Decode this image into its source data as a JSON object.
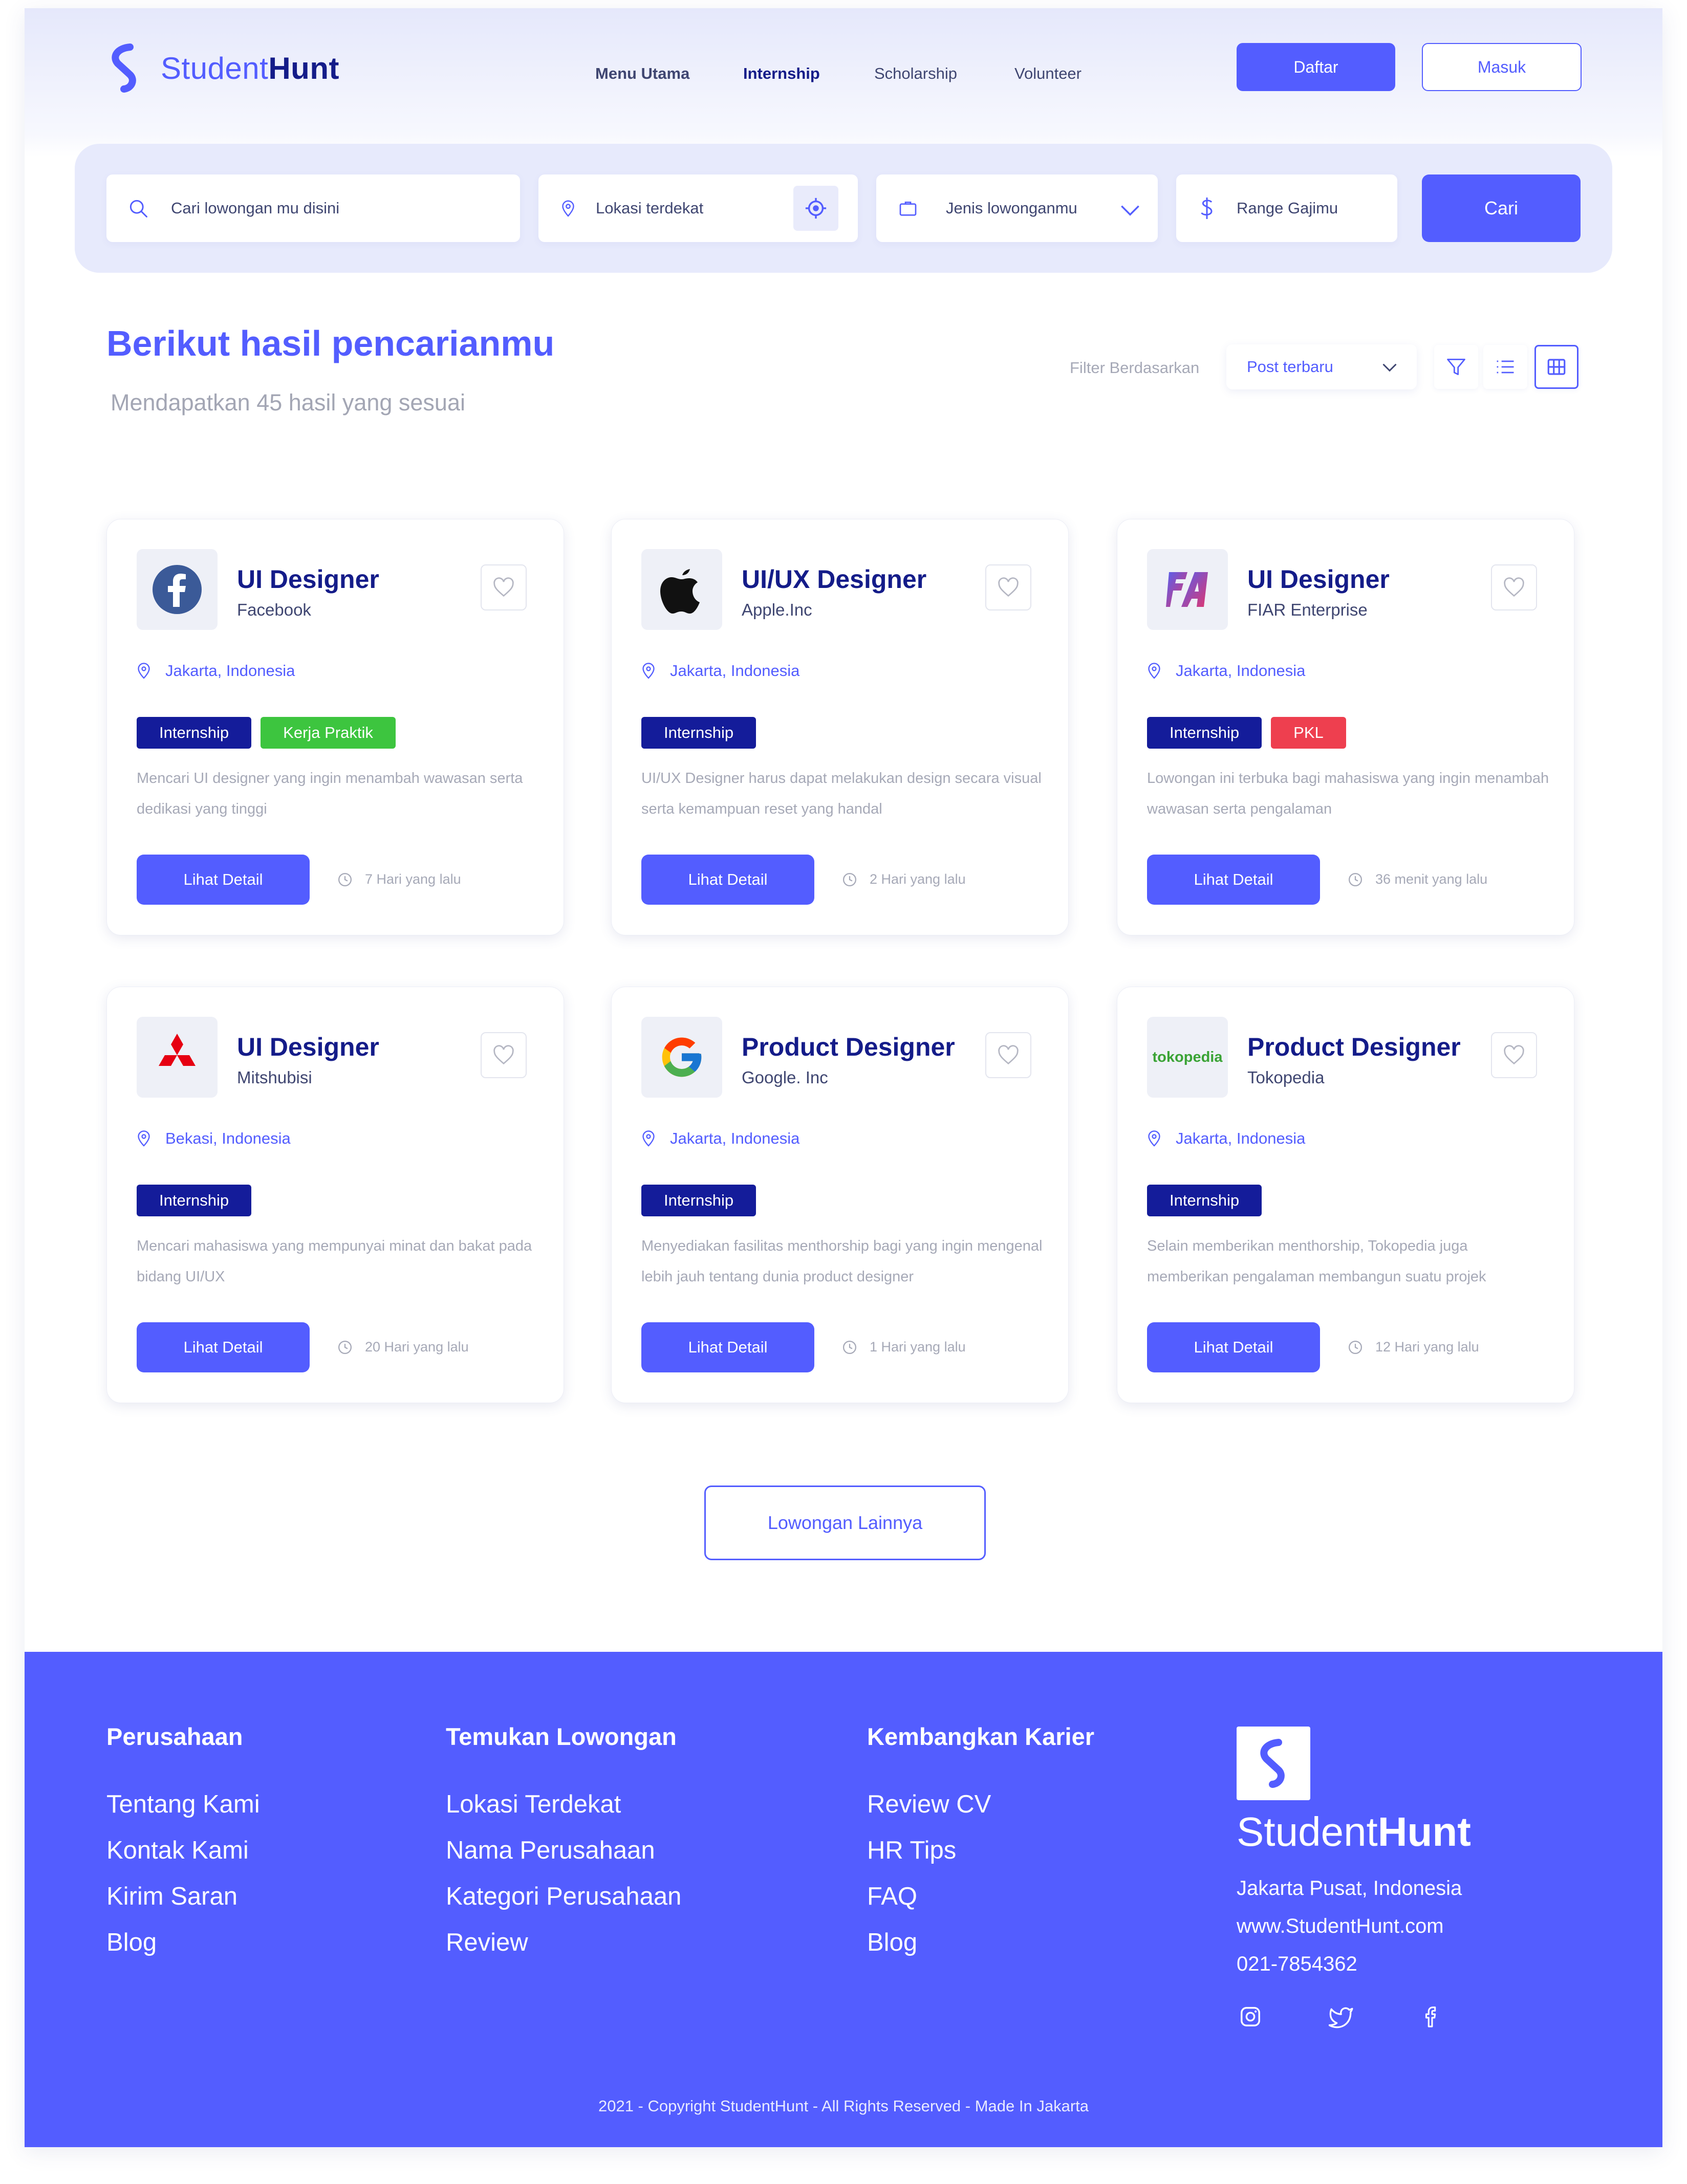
{
  "brand": {
    "prefix": "Student",
    "bold": "Hunt"
  },
  "nav": {
    "items": [
      "Menu Utama",
      "Internship",
      "Scholarship",
      "Volunteer"
    ],
    "active": "Internship"
  },
  "auth": {
    "register": "Daftar",
    "login": "Masuk"
  },
  "search": {
    "keyword_placeholder": "Cari lowongan mu disini",
    "location_placeholder": "Lokasi terdekat",
    "type_placeholder": "Jenis lowonganmu",
    "salary_placeholder": "Range Gajimu",
    "submit": "Cari"
  },
  "results": {
    "title": "Berikut hasil pencarianmu",
    "subtitle": "Mendapatkan 45 hasil yang sesuai",
    "filter_label": "Filter Berdasarkan",
    "filter_value": "Post terbaru",
    "active_view": "grid"
  },
  "jobs": [
    {
      "title": "UI Designer",
      "company": "Facebook",
      "logo": "facebook-logo",
      "location": "Jakarta, Indonesia",
      "tags": [
        {
          "label": "Internship",
          "color": "#141c9a"
        },
        {
          "label": "Kerja Praktik",
          "color": "#3dc53f"
        }
      ],
      "desc": "Mencari UI designer yang ingin menambah wawasan serta dedikasi yang tinggi",
      "button": "Lihat Detail",
      "posted": "7  Hari yang lalu"
    },
    {
      "title": "UI/UX Designer",
      "company": "Apple.Inc",
      "logo": "apple-logo",
      "location": "Jakarta, Indonesia",
      "tags": [
        {
          "label": "Internship",
          "color": "#141c9a"
        }
      ],
      "desc": "UI/UX Designer harus dapat melakukan design secara visual serta kemampuan reset yang handal",
      "button": "Lihat Detail",
      "posted": "2 Hari yang lalu"
    },
    {
      "title": "UI Designer",
      "company": "FIAR Enterprise",
      "logo": "fiar-logo",
      "location": "Jakarta, Indonesia",
      "tags": [
        {
          "label": "Internship",
          "color": "#141c9a"
        },
        {
          "label": "PKL",
          "color": "#ee3f4f"
        }
      ],
      "desc": "Lowongan ini terbuka bagi mahasiswa yang ingin menambah wawasan serta pengalaman",
      "button": "Lihat Detail",
      "posted": "36 menit yang lalu"
    },
    {
      "title": "UI Designer",
      "company": "Mitshubisi",
      "logo": "mitsubishi-logo",
      "location": "Bekasi, Indonesia",
      "tags": [
        {
          "label": "Internship",
          "color": "#141c9a"
        }
      ],
      "desc": "Mencari mahasiswa yang mempunyai minat dan bakat pada bidang UI/UX",
      "button": "Lihat Detail",
      "posted": "20 Hari yang lalu"
    },
    {
      "title": "Product Designer",
      "company": "Google. Inc",
      "logo": "google-logo",
      "location": "Jakarta, Indonesia",
      "tags": [
        {
          "label": "Internship",
          "color": "#141c9a"
        }
      ],
      "desc": "Menyediakan fasilitas menthorship bagi yang ingin mengenal lebih jauh tentang dunia product designer",
      "button": "Lihat Detail",
      "posted": "1  Hari yang lalu"
    },
    {
      "title": "Product Designer",
      "company": "Tokopedia",
      "logo": "tokopedia-logo",
      "logo_text": "tokopedia",
      "location": "Jakarta, Indonesia",
      "tags": [
        {
          "label": "Internship",
          "color": "#141c9a"
        }
      ],
      "desc": "Selain memberikan menthorship, Tokopedia juga memberikan pengalaman membangun suatu projek",
      "button": "Lihat Detail",
      "posted": "12 Hari yang lalu"
    }
  ],
  "more_button": "Lowongan Lainnya",
  "footer": {
    "columns": [
      {
        "title": "Perusahaan",
        "links": [
          "Tentang Kami",
          "Kontak Kami",
          "Kirim Saran",
          "Blog"
        ]
      },
      {
        "title": "Temukan Lowongan",
        "links": [
          "Lokasi Terdekat",
          "Nama Perusahaan",
          "Kategori Perusahaan",
          "Review"
        ]
      },
      {
        "title": "Kembangkan Karier",
        "links": [
          "Review CV",
          "HR Tips",
          "FAQ",
          "Blog"
        ]
      }
    ],
    "brand": {
      "prefix": "Student",
      "bold": "Hunt"
    },
    "address": "Jakarta Pusat, Indonesia",
    "website": "www.StudentHunt.com",
    "phone": "021-7854362",
    "social": [
      "instagram-icon",
      "twitter-icon",
      "facebook-icon"
    ],
    "copyright": "2021 - Copyright StudentHunt - All Rights Reserved -  Made In Jakarta"
  },
  "colors": {
    "primary": "#535dff",
    "navy": "#141c89",
    "muted": "#a6a9b7",
    "panel": "#e7eafc"
  }
}
